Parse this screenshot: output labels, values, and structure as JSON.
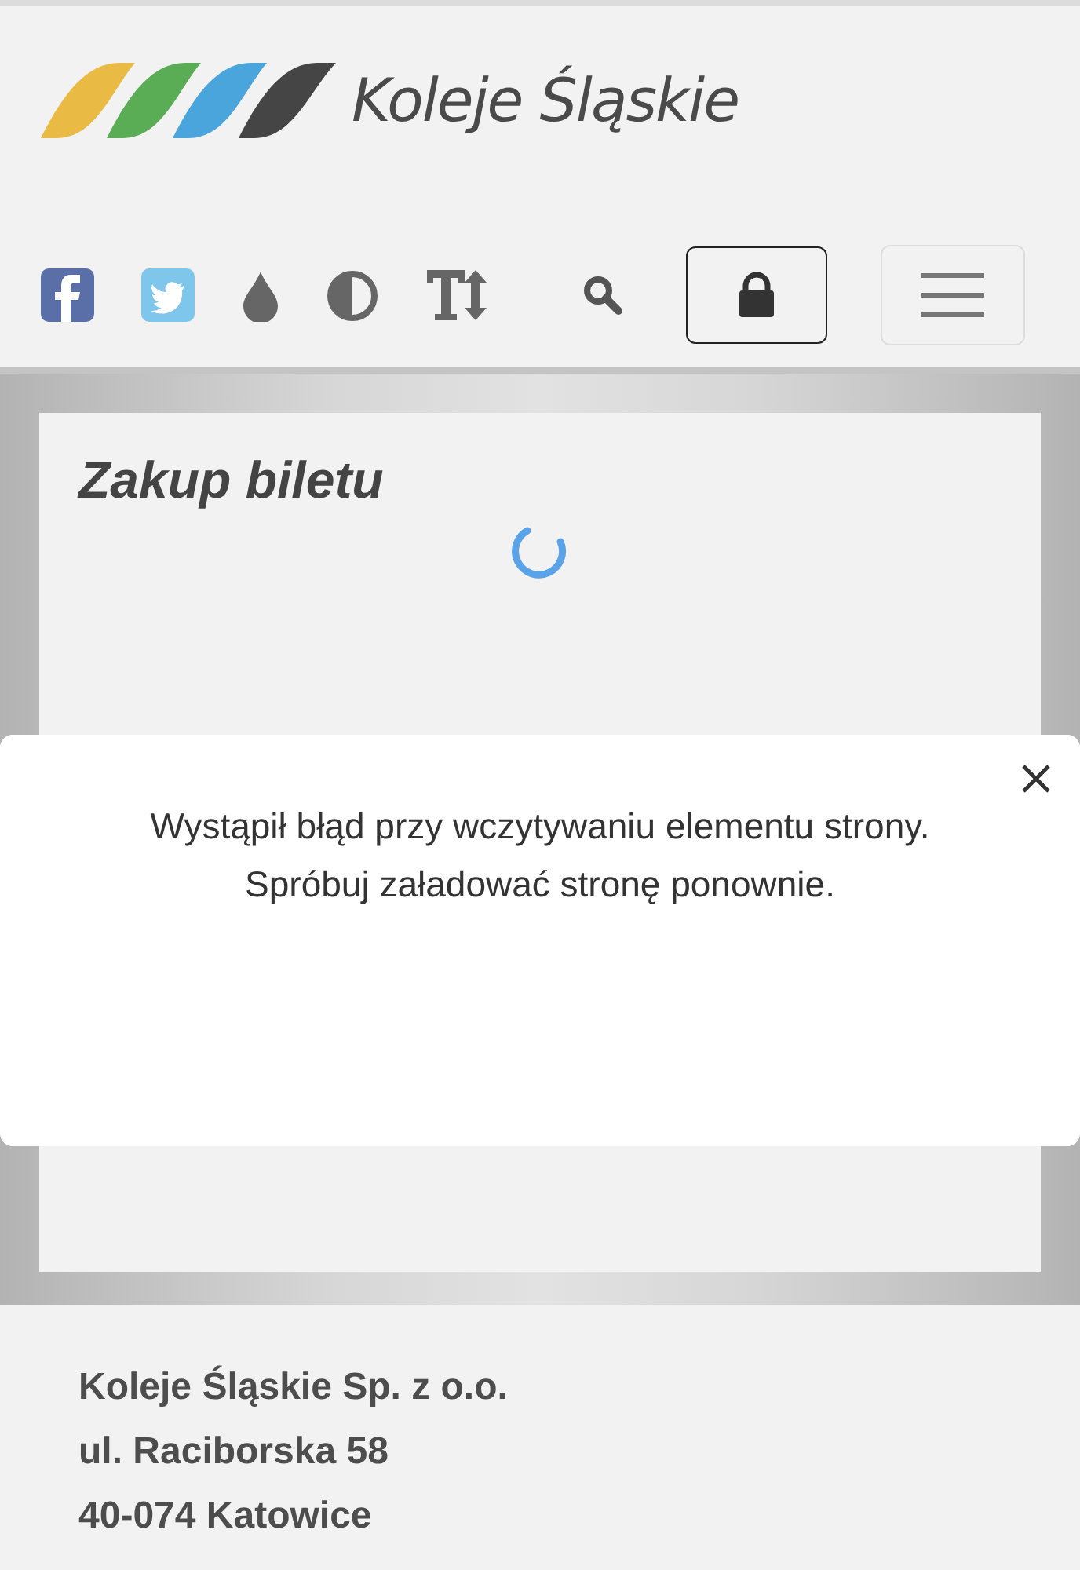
{
  "header": {
    "logo_text": "Koleje Śląskie"
  },
  "page": {
    "title": "Zakup biletu",
    "loading": true
  },
  "dialog": {
    "lines": [
      "Wystąpił błąd przy wczytywaniu elementu strony.",
      "Spróbuj załadować stronę ponownie."
    ]
  },
  "footer": {
    "lines": [
      "Koleje Śląskie Sp. z o.o.",
      "ul. Raciborska 58",
      "40-074 Katowice"
    ]
  }
}
